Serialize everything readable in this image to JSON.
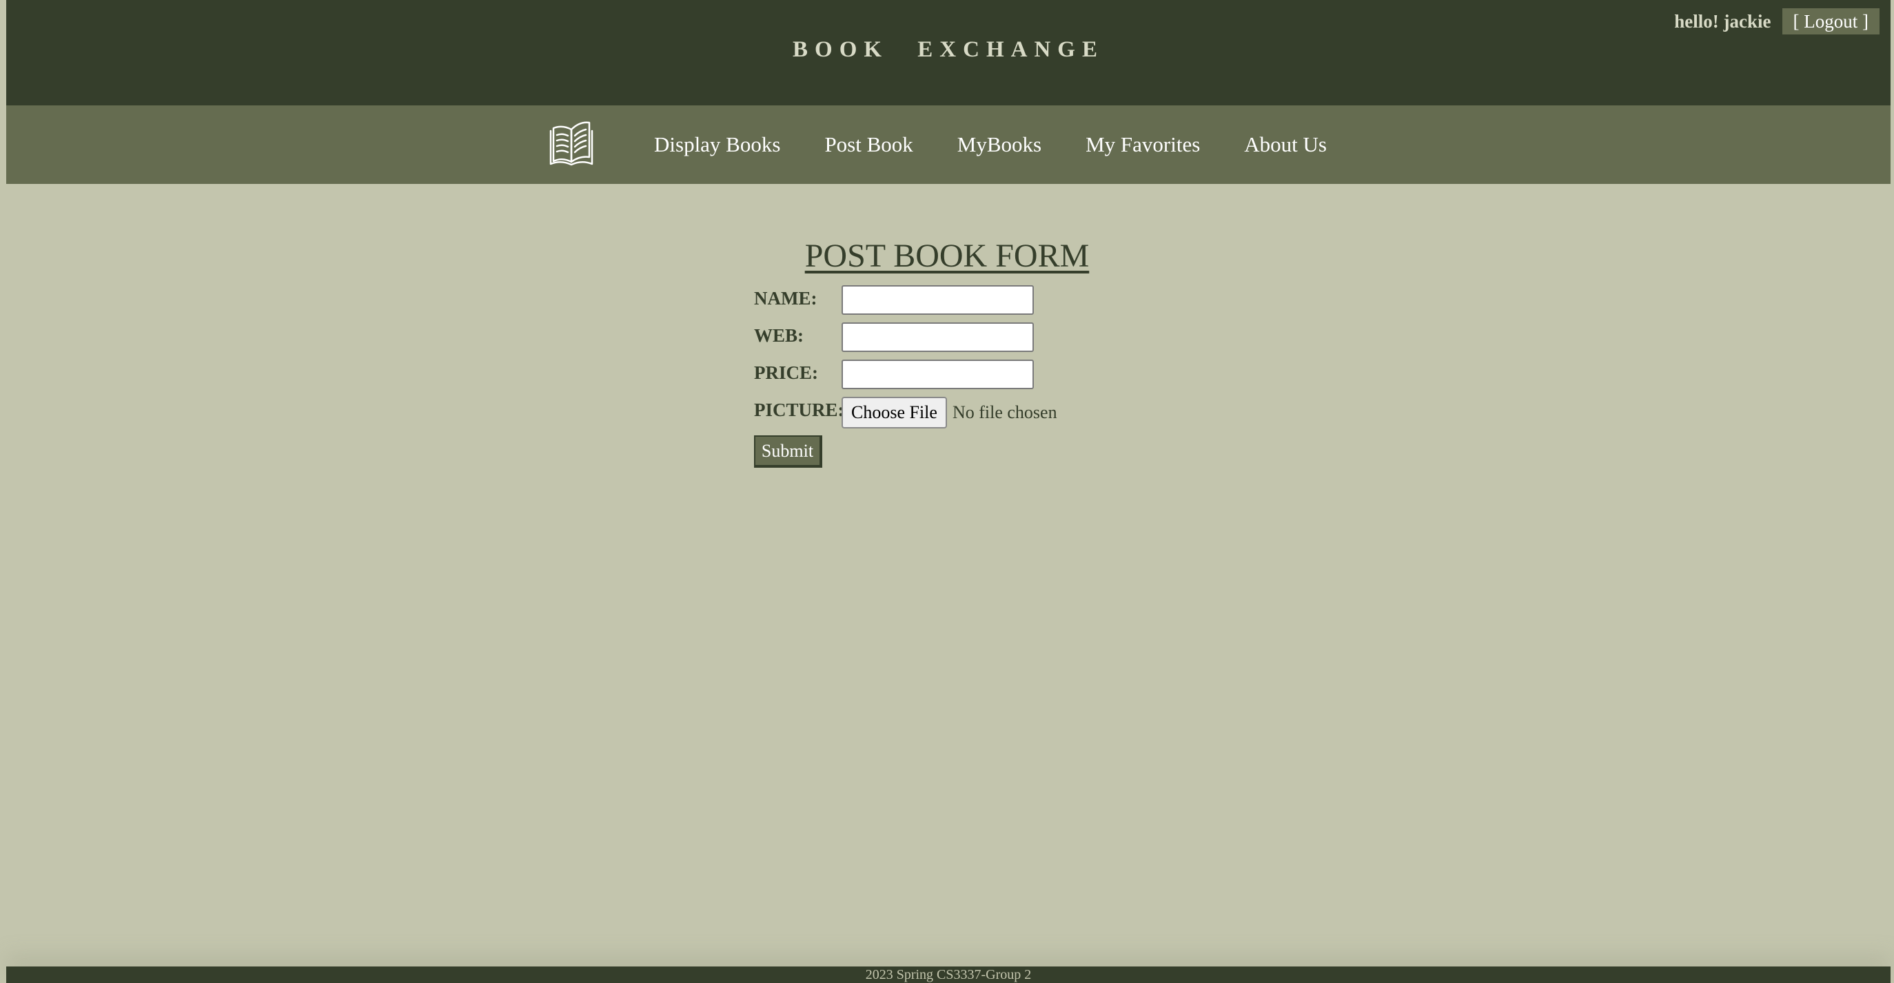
{
  "header": {
    "site_title": "BOOK EXCHANGE",
    "greeting": "hello! jackie",
    "logout_label": "[ Logout ]"
  },
  "nav": {
    "logo_icon": "open-book-icon",
    "items": [
      {
        "label": "Display Books"
      },
      {
        "label": "Post Book"
      },
      {
        "label": "MyBooks"
      },
      {
        "label": "My Favorites"
      },
      {
        "label": "About Us"
      }
    ]
  },
  "form": {
    "title": "POST BOOK FORM",
    "name_label": "NAME:",
    "name_value": "",
    "web_label": "WEB:",
    "web_value": "",
    "price_label": "PRICE:",
    "price_value": "",
    "picture_label": "PICTURE:",
    "file_button_label": "Choose File",
    "file_status": "No file chosen",
    "submit_label": "Submit"
  },
  "footer": {
    "text": "2023 Spring CS3337-Group 2"
  },
  "colors": {
    "header_bg": "#353e2b",
    "nav_bg": "#656c50",
    "page_bg": "#c3c5ad"
  }
}
